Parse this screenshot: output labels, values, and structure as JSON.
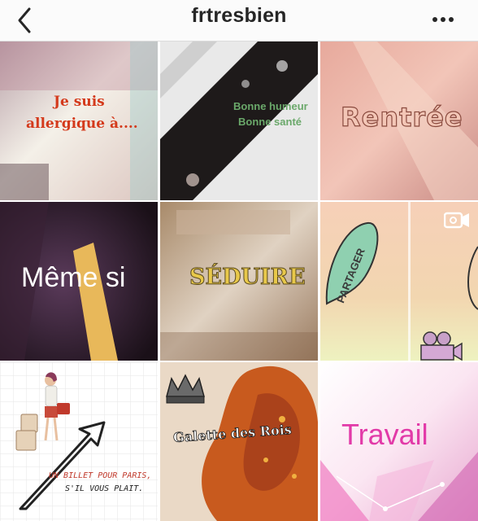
{
  "header": {
    "title": "frtresbien",
    "back_icon": "chevron-left-icon",
    "more_icon": "more-horizontal-icon"
  },
  "posts": [
    {
      "lines": [
        "Je suis",
        "allergique à...."
      ],
      "color": "#d43a1c"
    },
    {
      "lines": [
        "Bonne humeur",
        "Bonne santé"
      ],
      "color": "#6aa86a"
    },
    {
      "text": "Rentrée",
      "color": "#e8b6a6"
    },
    {
      "text": "Même si",
      "color": "#ffffff"
    },
    {
      "text": "Séduire",
      "color": "#e8c84a"
    },
    {
      "text": "PARTAGER",
      "type_icon": "video-camera-icon",
      "color": "#3a3a3a"
    },
    {
      "lines": [
        "UN BILLET POUR PARIS,",
        "S'IL VOUS PLAIT."
      ],
      "color": "#c0392b"
    },
    {
      "text": "Galette des Rois",
      "color": "#ffffff"
    },
    {
      "text": "Travail",
      "color": "#e23aa8"
    }
  ]
}
